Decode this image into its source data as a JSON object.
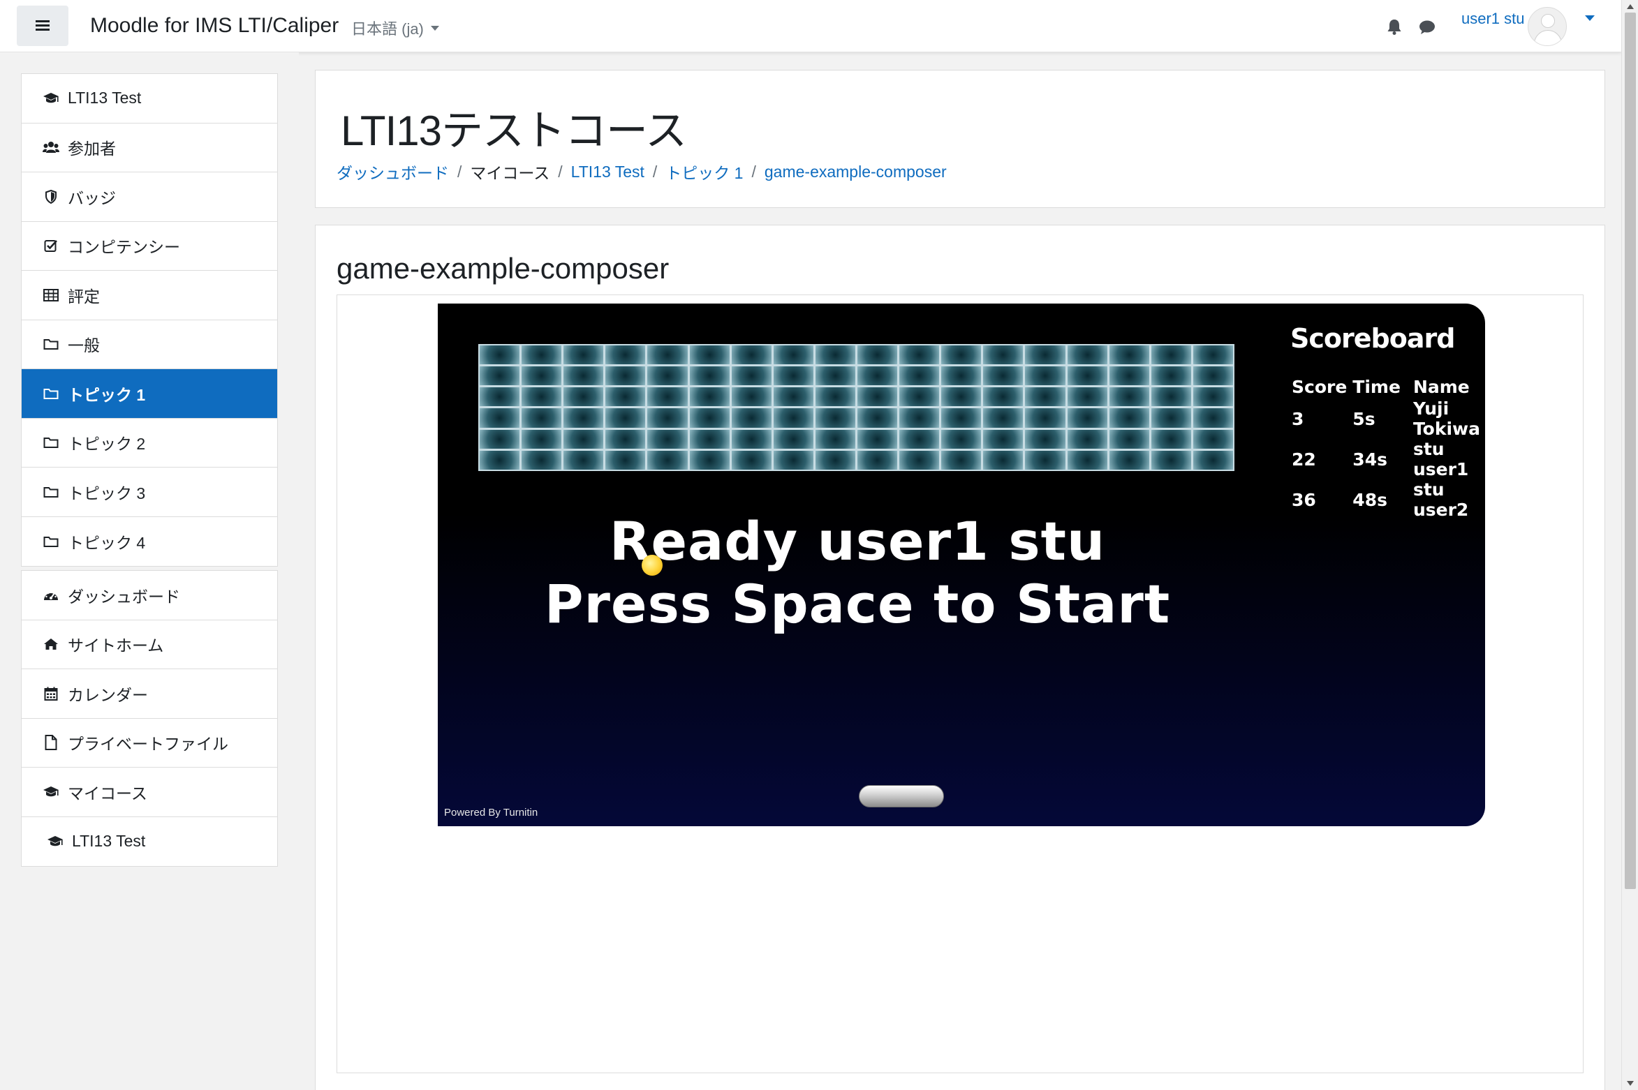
{
  "navbar": {
    "site_name": "Moodle for IMS LTI/Caliper",
    "language": "日本語 (ja)",
    "user_name": "user1 stu"
  },
  "sidebar": {
    "course_items": [
      {
        "label": "LTI13 Test",
        "icon": "graduation-cap-icon"
      },
      {
        "label": "参加者",
        "icon": "users-icon"
      },
      {
        "label": "バッジ",
        "icon": "shield-icon"
      },
      {
        "label": "コンピテンシー",
        "icon": "checkbox-icon"
      },
      {
        "label": "評定",
        "icon": "table-icon"
      },
      {
        "label": "一般",
        "icon": "folder-icon"
      },
      {
        "label": "トピック 1",
        "icon": "folder-icon",
        "active": true
      },
      {
        "label": "トピック 2",
        "icon": "folder-icon"
      },
      {
        "label": "トピック 3",
        "icon": "folder-icon"
      },
      {
        "label": "トピック 4",
        "icon": "folder-icon"
      }
    ],
    "site_items": [
      {
        "label": "ダッシュボード",
        "icon": "dashboard-icon"
      },
      {
        "label": "サイトホーム",
        "icon": "home-icon"
      },
      {
        "label": "カレンダー",
        "icon": "calendar-icon"
      },
      {
        "label": "プライベートファイル",
        "icon": "file-icon"
      },
      {
        "label": "マイコース",
        "icon": "graduation-cap-icon"
      },
      {
        "label": "LTI13 Test",
        "icon": "graduation-cap-icon"
      }
    ]
  },
  "header": {
    "course_title": "LTI13テストコース",
    "breadcrumb": [
      "ダッシュボード",
      "マイコース",
      "LTI13 Test",
      "トピック 1",
      "game-example-composer"
    ]
  },
  "activity": {
    "title": "game-example-composer"
  },
  "game": {
    "scoreboard_title": "Scoreboard",
    "columns": [
      "Score",
      "Time",
      "Name"
    ],
    "rows": [
      {
        "score": "3",
        "time": "5s",
        "name": "Yuji Tokiwa"
      },
      {
        "score": "22",
        "time": "34s",
        "name": "stu user1"
      },
      {
        "score": "36",
        "time": "48s",
        "name": "stu user2"
      }
    ],
    "ready_line": "Ready user1 stu",
    "start_line": "Press Space to Start",
    "powered_by": "Powered By Turnitin"
  },
  "colors": {
    "accent": "#0f6cbf",
    "game_bg": "#000000",
    "brick_border": "#c7dce3"
  }
}
